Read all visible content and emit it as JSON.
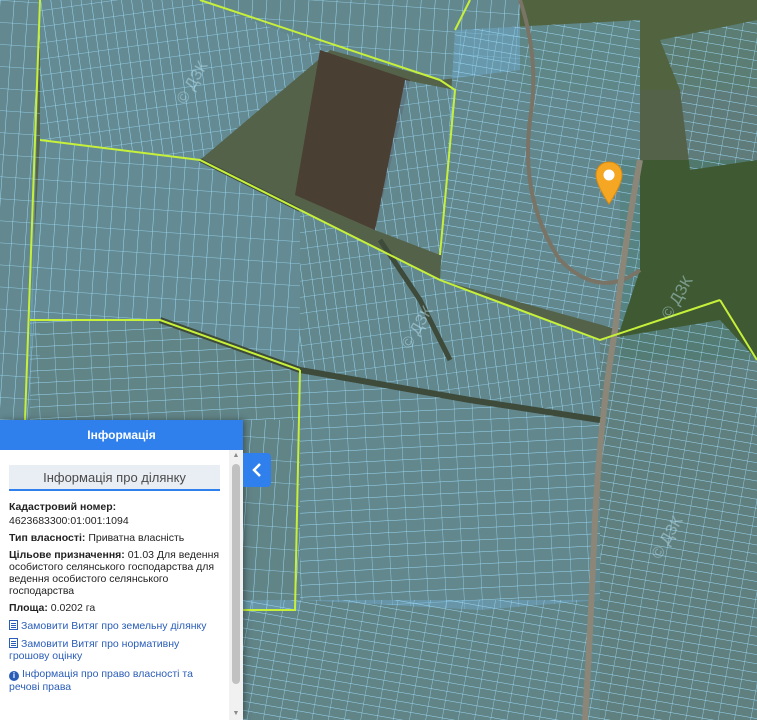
{
  "map": {
    "watermark": "© ДЗК"
  },
  "info_panel": {
    "header": "Інформація",
    "section_title": "Інформація про ділянку",
    "cadastral_label": "Кадастровий номер:",
    "cadastral_value": "4623683300:01:001:1094",
    "ownership_label": "Тип власності:",
    "ownership_value": "Приватна власність",
    "purpose_label": "Цільове призначення:",
    "purpose_value": "01.03 Для ведення особистого селянського господарства для ведення особистого селянського господарства",
    "area_label": "Площа:",
    "area_value": "0.0202 га",
    "link_land_extract": "Замовити Витяг про земельну ділянку",
    "link_valuation_extract": "Замовити Витяг про нормативну грошову оцінку",
    "link_ownership_info": "Інформація про право власності та речові права"
  },
  "colors": {
    "accent": "#2f80ed",
    "parcel_outline": "#8fd3ff",
    "boundary": "#c6f03a",
    "marker": "#f5a623"
  }
}
